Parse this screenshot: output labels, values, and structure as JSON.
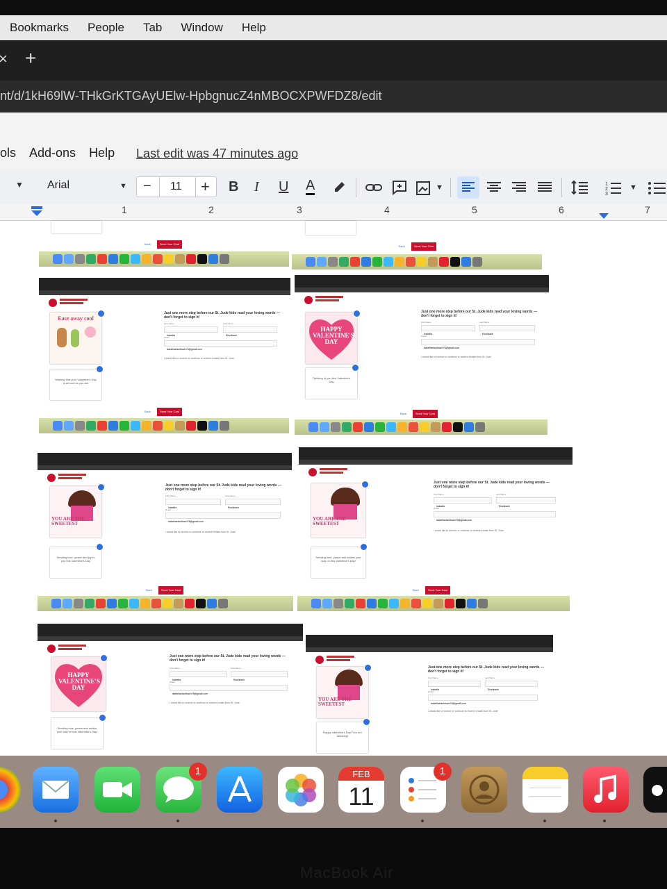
{
  "menu_bar": [
    "Bookmarks",
    "People",
    "Tab",
    "Window",
    "Help"
  ],
  "tab_bar": {
    "close_glyph": "×",
    "new_tab_glyph": "+"
  },
  "url": "nt/d/1kH69lW-THkGrKTGAyUElw-HpbgnucZ4nMBOCXPWFDZ8/edit",
  "doc_menu": [
    "ols",
    "Add-ons",
    "Help"
  ],
  "last_edit": "Last edit was 47 minutes ago",
  "toolbar": {
    "font": "Arial",
    "size": "11",
    "minus": "−",
    "plus": "+",
    "bold": "B",
    "italic": "I",
    "underline": "U",
    "text_color": "A"
  },
  "ruler_numbers": [
    "1",
    "2",
    "3",
    "4",
    "5",
    "6",
    "7"
  ],
  "screenshots": {
    "send_card": "Send Your Card",
    "back": "Back",
    "sign_heading": "Just one more step before our St. Jude kids read your loving words — don't forget to sign it!",
    "first_name_label": "First Name",
    "last_name_label": "Last Name",
    "email_label": "Email",
    "first_name": "Isabella",
    "last_name": "Eischbach",
    "email": "isabellaeischbach76@gmail.com",
    "optin": "I would like to receive or continue to receive emails from St. Jude",
    "cards": [
      {
        "art": "Ease away cool",
        "msg": "Wishing that your Valentine's Day is as cool as you are"
      },
      {
        "art": "HAPPY VALENTINE'S DAY",
        "msg": "Thinking of you this Valentine's Day"
      },
      {
        "art": "YOU ARE THE SWEETEST",
        "msg": "Sending love, peace and joy to you this Valentine's Day"
      },
      {
        "art": "YOU ARE THE SWEETEST",
        "msg": "Sending love, peace and smiles your way on this Valentine's Day!"
      },
      {
        "art": "HAPPY VALENTINE'S DAY",
        "msg": "Sending love, peace and smiles your way on this Valentine's Day!"
      },
      {
        "art": "YOU ARE THE SWEETEST",
        "msg": "Happy Valentine's Day! You are amazing!"
      }
    ]
  },
  "dock": {
    "calendar_month": "FEB",
    "calendar_day": "11",
    "messages_badge": "1",
    "reminders_badge": "1"
  },
  "bezel_label": "MacBook Air"
}
